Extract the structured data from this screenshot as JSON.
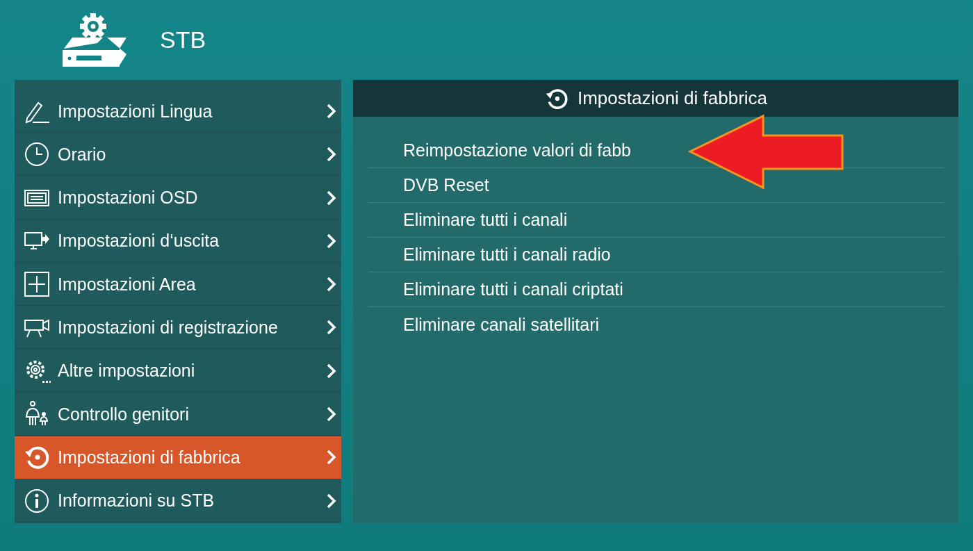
{
  "header": {
    "title": "STB"
  },
  "menu": [
    {
      "label": "Impostazioni Lingua",
      "selected": false
    },
    {
      "label": "Orario",
      "selected": false
    },
    {
      "label": "Impostazioni OSD",
      "selected": false
    },
    {
      "label": "Impostazioni d‘uscita",
      "selected": false
    },
    {
      "label": "Impostazioni Area",
      "selected": false
    },
    {
      "label": "Impostazioni di registrazione",
      "selected": false
    },
    {
      "label": "Altre impostazioni",
      "selected": false
    },
    {
      "label": "Controllo genitori",
      "selected": false
    },
    {
      "label": "Impostazioni di fabbrica",
      "selected": true
    },
    {
      "label": "Informazioni su STB",
      "selected": false
    }
  ],
  "panel": {
    "title": "Impostazioni di fabbrica",
    "items": [
      {
        "label": "Reimpostazione valori di fabb",
        "annotated": true
      },
      {
        "label": "DVB Reset",
        "annotated": false
      },
      {
        "label": "Eliminare tutti i canali",
        "annotated": false
      },
      {
        "label": "Eliminare tutti i canali radio",
        "annotated": false
      },
      {
        "label": "Eliminare tutti i canali criptati",
        "annotated": false
      },
      {
        "label": "Eliminare canali satellitari",
        "annotated": false
      }
    ]
  }
}
